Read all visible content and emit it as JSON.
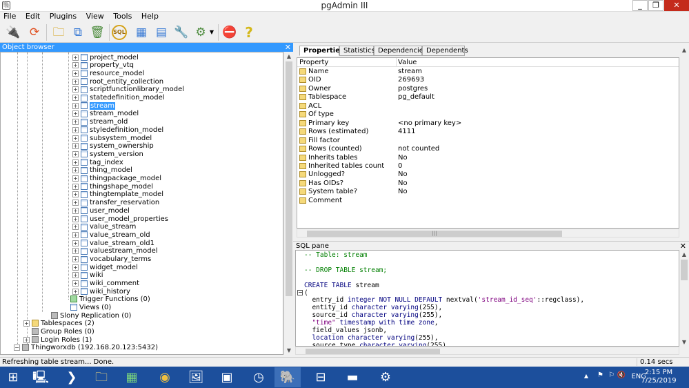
{
  "window": {
    "title": "pgAdmin III",
    "app_icon": "elephant-icon",
    "controls": [
      "_",
      "❐",
      "✕"
    ]
  },
  "menu": [
    "File",
    "Edit",
    "Plugins",
    "View",
    "Tools",
    "Help"
  ],
  "toolbar": {
    "buttons": [
      "plug-icon",
      "refresh-icon",
      "folder-icon",
      "copy-icon",
      "trash-icon",
      "sql-icon",
      "grid-icon",
      "filter-icon",
      "wrench-icon",
      "plugin-icon",
      "plugin-dropdown-icon",
      "stop-icon",
      "help-icon"
    ],
    "sql_label": "SQL"
  },
  "object_browser": {
    "title": "Object browser",
    "tables": [
      "project_model",
      "property_vtq",
      "resource_model",
      "root_entity_collection",
      "scriptfunctionlibrary_model",
      "statedefinition_model",
      "stream",
      "stream_model",
      "stream_old",
      "styledefinition_model",
      "subsystem_model",
      "system_ownership",
      "system_version",
      "tag_index",
      "thing_model",
      "thingpackage_model",
      "thingshape_model",
      "thingtemplate_model",
      "transfer_reservation",
      "user_model",
      "user_model_properties",
      "value_stream",
      "value_stream_old",
      "value_stream_old1",
      "valuestream_model",
      "vocabulary_terms",
      "widget_model",
      "wiki",
      "wiki_comment",
      "wiki_history"
    ],
    "selected_table": "stream",
    "schema_nodes": [
      "Trigger Functions (0)",
      "Views (0)"
    ],
    "db_nodes": [
      "Slony Replication (0)"
    ],
    "server_nodes": [
      "Tablespaces (2)",
      "Group Roles (0)",
      "Login Roles (1)"
    ],
    "root_node": "Thingworxdb (192.168.20.123:5432)"
  },
  "properties": {
    "tabs": [
      "Properties",
      "Statistics",
      "Dependencies",
      "Dependents"
    ],
    "columns": [
      "Property",
      "Value"
    ],
    "rows": [
      {
        "p": "Name",
        "v": "stream"
      },
      {
        "p": "OID",
        "v": "269693"
      },
      {
        "p": "Owner",
        "v": "postgres"
      },
      {
        "p": "Tablespace",
        "v": "pg_default"
      },
      {
        "p": "ACL",
        "v": ""
      },
      {
        "p": "Of type",
        "v": ""
      },
      {
        "p": "Primary key",
        "v": "<no primary key>"
      },
      {
        "p": "Rows (estimated)",
        "v": "4111"
      },
      {
        "p": "Fill factor",
        "v": ""
      },
      {
        "p": "Rows (counted)",
        "v": "not counted"
      },
      {
        "p": "Inherits tables",
        "v": "No"
      },
      {
        "p": "Inherited tables count",
        "v": "0"
      },
      {
        "p": "Unlogged?",
        "v": "No"
      },
      {
        "p": "Has OIDs?",
        "v": "No"
      },
      {
        "p": "System table?",
        "v": "No"
      },
      {
        "p": "Comment",
        "v": ""
      }
    ]
  },
  "sql_pane": {
    "title": "SQL pane",
    "lines": [
      [
        {
          "t": "-- Table: stream",
          "c": "cm"
        }
      ],
      [
        {
          "t": "",
          "c": ""
        }
      ],
      [
        {
          "t": "-- DROP TABLE stream;",
          "c": "cm"
        }
      ],
      [
        {
          "t": "",
          "c": ""
        }
      ],
      [
        {
          "t": "CREATE TABLE",
          "c": "kw"
        },
        {
          "t": " stream",
          "c": ""
        }
      ],
      [
        {
          "t": "(",
          "c": ""
        }
      ],
      [
        {
          "t": "  entry_id ",
          "c": ""
        },
        {
          "t": "integer NOT NULL DEFAULT",
          "c": "kw"
        },
        {
          "t": " nextval(",
          "c": ""
        },
        {
          "t": "'stream_id_seq'",
          "c": "st"
        },
        {
          "t": "::regclass),",
          "c": ""
        }
      ],
      [
        {
          "t": "  entity_id ",
          "c": ""
        },
        {
          "t": "character varying",
          "c": "kw"
        },
        {
          "t": "(255),",
          "c": ""
        }
      ],
      [
        {
          "t": "  source_id ",
          "c": ""
        },
        {
          "t": "character varying",
          "c": "kw"
        },
        {
          "t": "(255),",
          "c": ""
        }
      ],
      [
        {
          "t": "  ",
          "c": ""
        },
        {
          "t": "\"time\"",
          "c": "st"
        },
        {
          "t": " ",
          "c": ""
        },
        {
          "t": "timestamp with time zone",
          "c": "kw"
        },
        {
          "t": ",",
          "c": ""
        }
      ],
      [
        {
          "t": "  field_values jsonb,",
          "c": ""
        }
      ],
      [
        {
          "t": "  ",
          "c": ""
        },
        {
          "t": "location character varying",
          "c": "kw"
        },
        {
          "t": "(255),",
          "c": ""
        }
      ],
      [
        {
          "t": "  source_type ",
          "c": ""
        },
        {
          "t": "character varying",
          "c": "kw"
        },
        {
          "t": "(255)",
          "c": ""
        }
      ]
    ]
  },
  "status": {
    "message": "Refreshing table stream... Done.",
    "elapsed": "0.14 secs"
  },
  "taskbar": {
    "apps": [
      "windows-start-icon",
      "server-manager-icon",
      "powershell-icon",
      "file-explorer-icon",
      "store-icon",
      "chrome-icon",
      "image-viewer-icon",
      "photos-icon",
      "clock-app-icon",
      "pgadmin-icon",
      "network-icon",
      "cmd-icon",
      "settings-gear-icon"
    ],
    "tray_lang": "ENG",
    "time": "2:15 PM",
    "date": "7/25/2019"
  }
}
